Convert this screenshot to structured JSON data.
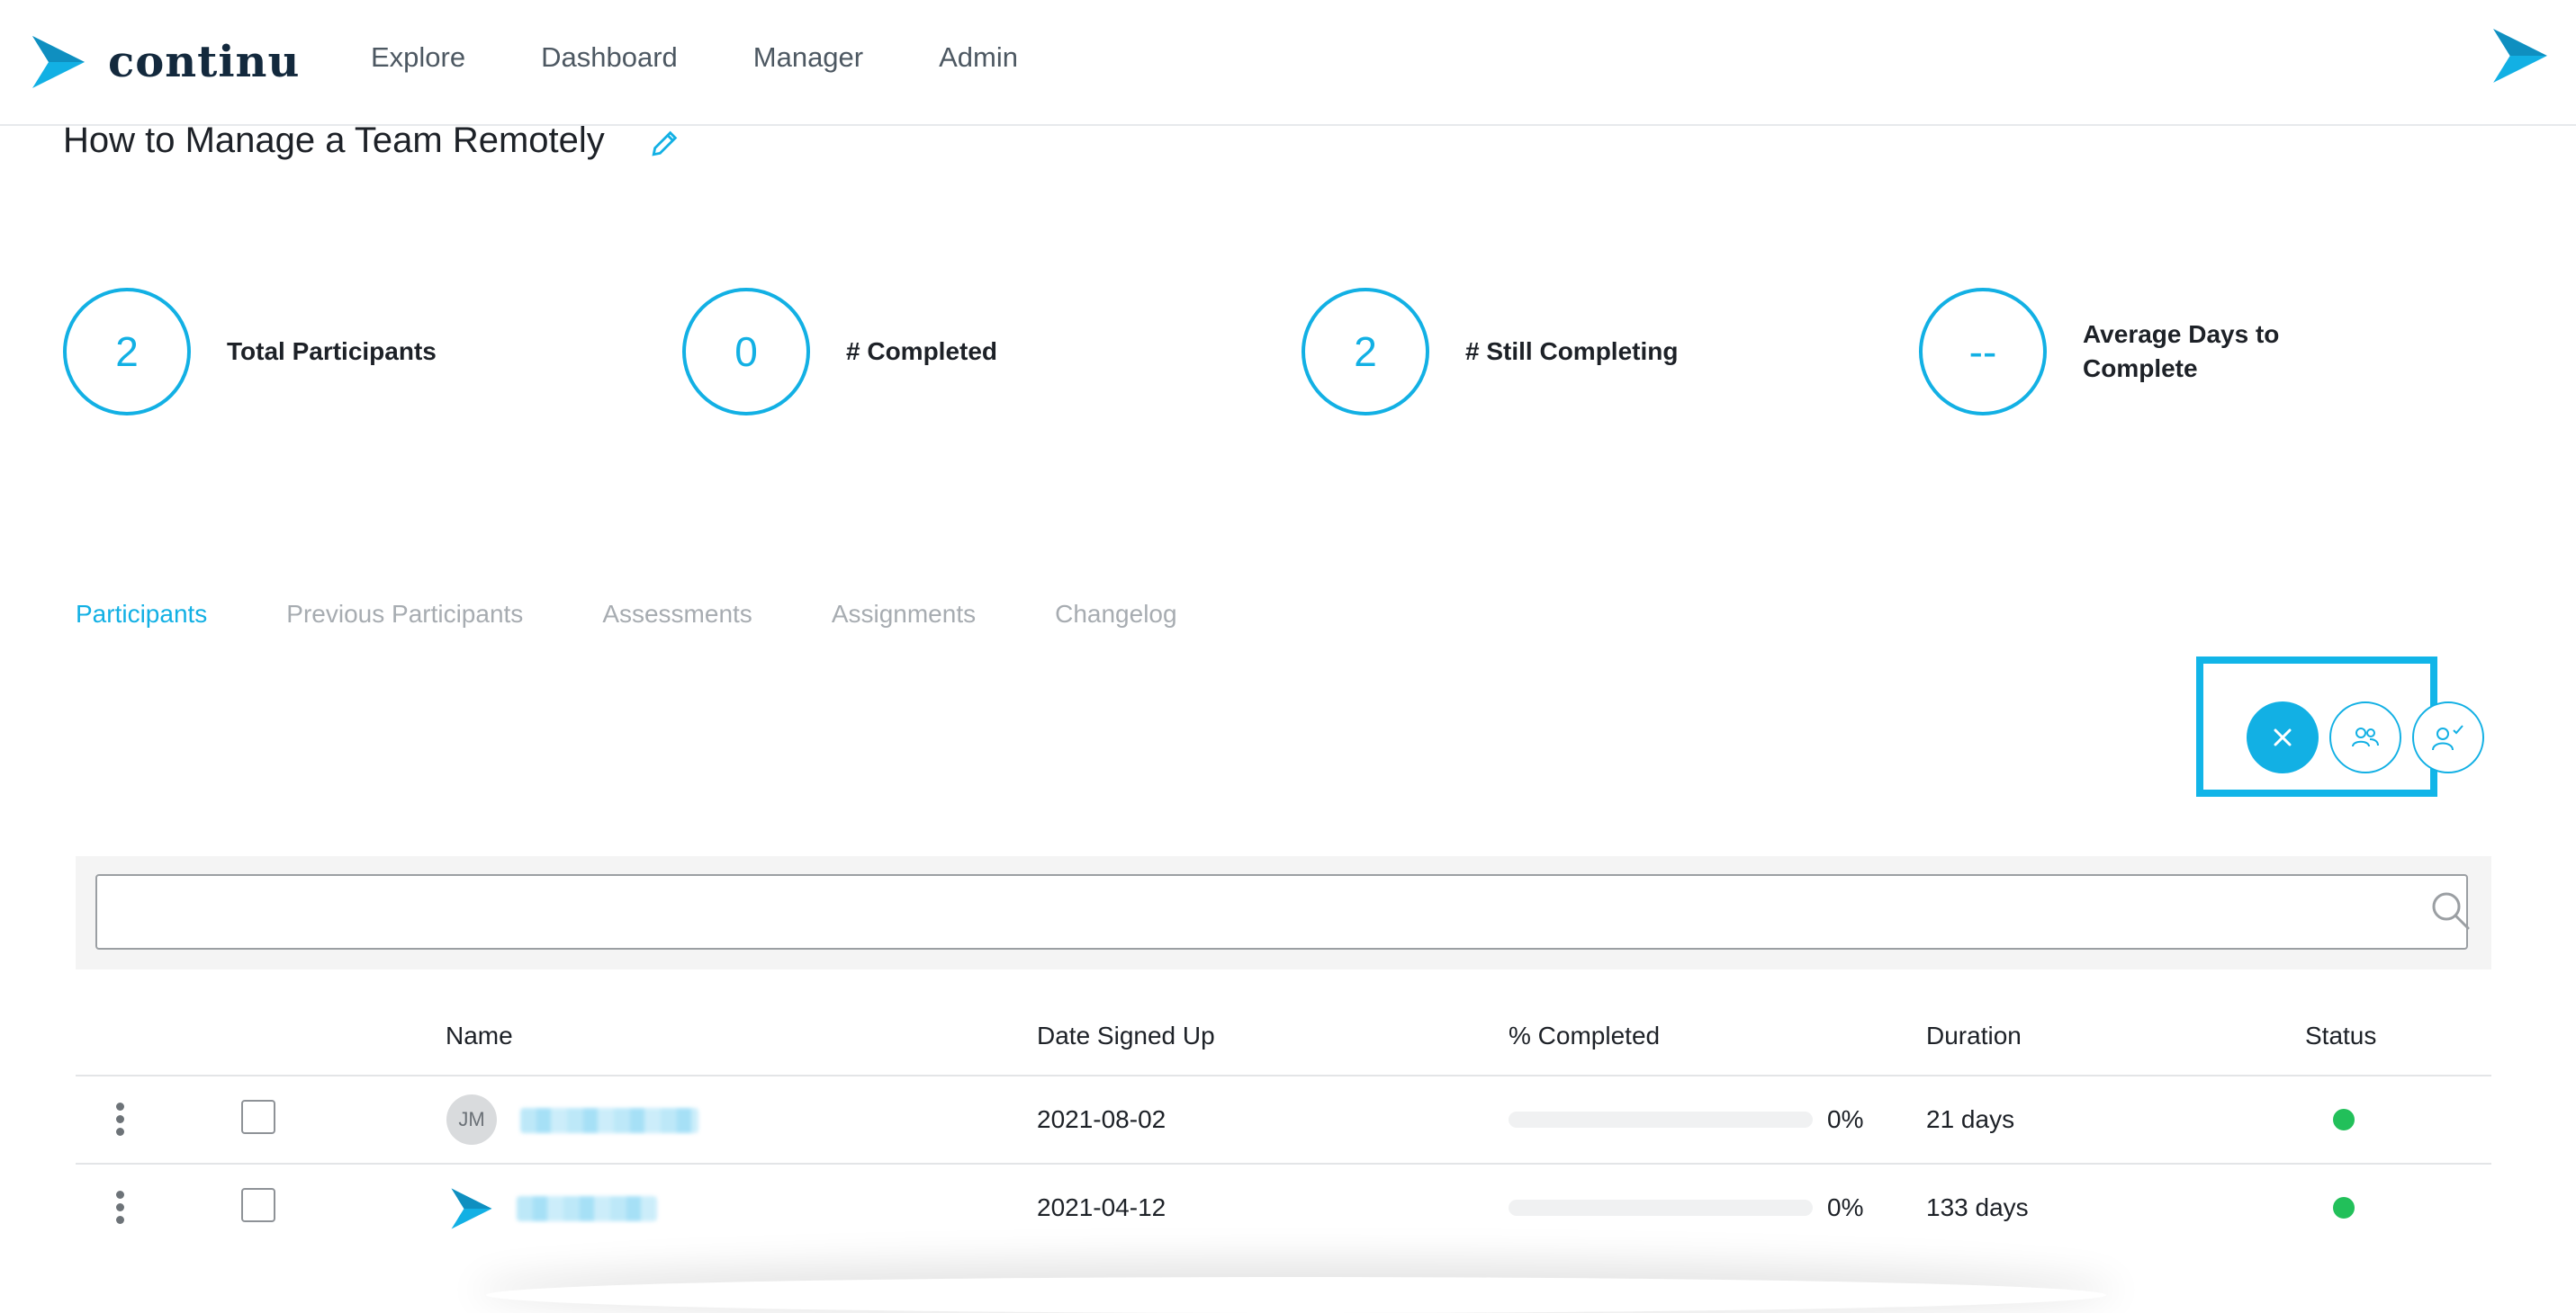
{
  "header": {
    "brand": "continu",
    "nav": [
      "Explore",
      "Dashboard",
      "Manager",
      "Admin"
    ]
  },
  "page": {
    "title": "How to Manage a Team Remotely"
  },
  "stats": [
    {
      "value": "2",
      "label": "Total Participants"
    },
    {
      "value": "0",
      "label": "# Completed"
    },
    {
      "value": "2",
      "label": "# Still Completing"
    },
    {
      "value": "--",
      "label": "Average Days to Complete"
    }
  ],
  "tabs": [
    "Participants",
    "Previous Participants",
    "Assessments",
    "Assignments",
    "Changelog"
  ],
  "active_tab": "Participants",
  "search": {
    "placeholder": ""
  },
  "table": {
    "columns": [
      "Name",
      "Date Signed Up",
      "% Completed",
      "Duration",
      "Status"
    ],
    "rows": [
      {
        "avatar": "JM",
        "date": "2021-08-02",
        "percent": "0%",
        "duration": "21 days",
        "status": "active"
      },
      {
        "avatar": "logo",
        "date": "2021-04-12",
        "percent": "0%",
        "duration": "133 days",
        "status": "active"
      }
    ]
  },
  "colors": {
    "accent": "#12b0e4",
    "status_active": "#22c05a",
    "brand_dark": "#13293d"
  },
  "icons": [
    "continu-logo-icon",
    "pencil-icon",
    "close-icon",
    "group-icon",
    "user-check-icon",
    "search-icon",
    "kebab-menu-icon"
  ]
}
